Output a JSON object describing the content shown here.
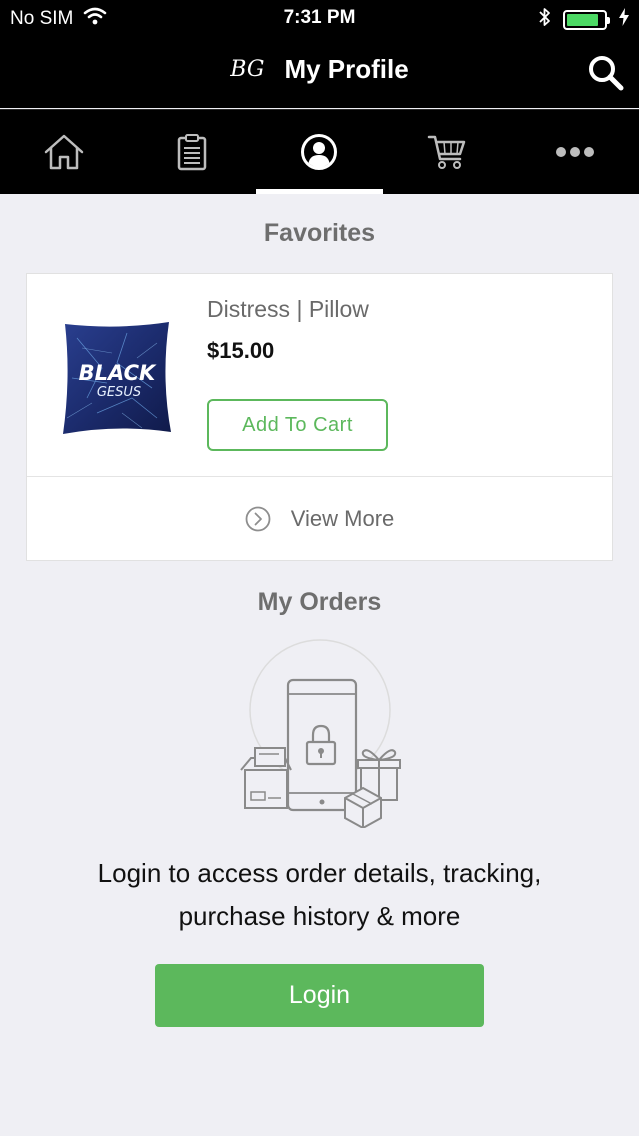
{
  "status_bar": {
    "carrier": "No SIM",
    "time": "7:31 PM",
    "battery_level": 0.85,
    "icons": [
      "wifi-icon",
      "bluetooth-icon",
      "battery-icon",
      "charging-icon"
    ]
  },
  "header": {
    "logo_text": "BG",
    "title": "My Profile",
    "icons": [
      "brand-logo",
      "search-icon"
    ]
  },
  "tabs": [
    {
      "icon": "home-icon",
      "active": false
    },
    {
      "icon": "clipboard-icon",
      "active": false
    },
    {
      "icon": "profile-icon",
      "active": true
    },
    {
      "icon": "cart-icon",
      "active": false
    },
    {
      "icon": "more-icon",
      "active": false
    }
  ],
  "favorites": {
    "title": "Favorites",
    "items": [
      {
        "name": "Distress | Pillow",
        "price": "$15.00",
        "add_to_cart_label": "Add To Cart",
        "image_text": [
          "BLACK",
          "GESUS"
        ]
      }
    ],
    "view_more_label": "View More"
  },
  "orders": {
    "title": "My Orders",
    "message_line1": "Login to access order details, tracking,",
    "message_line2": "purchase history & more",
    "login_label": "Login"
  },
  "colors": {
    "accent": "#5cb85c",
    "bar_background": "#000000",
    "page_background": "#efeff4"
  }
}
